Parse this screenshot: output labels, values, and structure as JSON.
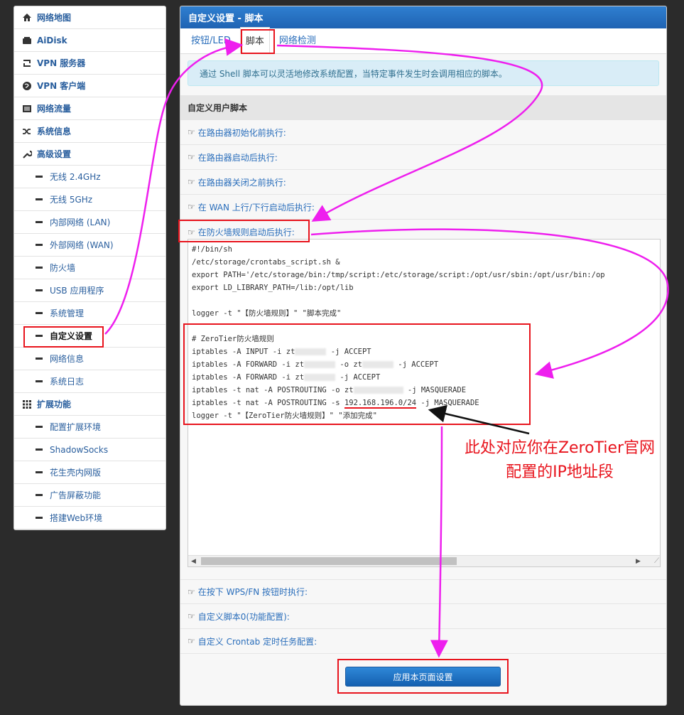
{
  "sidebar": {
    "items": [
      {
        "label": "网络地图",
        "icon": "home-icon"
      },
      {
        "label": "AiDisk",
        "icon": "disk-icon"
      },
      {
        "label": "VPN 服务器",
        "icon": "retweet-icon"
      },
      {
        "label": "VPN 客户端",
        "icon": "globe-icon"
      },
      {
        "label": "网络流量",
        "icon": "traffic-icon"
      },
      {
        "label": "系统信息",
        "icon": "shuffle-icon"
      },
      {
        "label": "高级设置",
        "icon": "wrench-icon"
      }
    ],
    "advanced_sub": [
      "无线 2.4GHz",
      "无线 5GHz",
      "内部网络 (LAN)",
      "外部网络 (WAN)",
      "防火墙",
      "USB 应用程序",
      "系统管理",
      "自定义设置",
      "网络信息",
      "系统日志"
    ],
    "ext_label": "扩展功能",
    "ext_sub": [
      "配置扩展环境",
      "ShadowSocks",
      "花生壳内网版",
      "广告屏蔽功能",
      "搭建Web环境"
    ]
  },
  "panel": {
    "title": "自定义设置 - 脚本",
    "tabs": [
      "按钮/LED",
      "脚本",
      "网络检测"
    ],
    "info": "通过 Shell 脚本可以灵活地修改系统配置，当特定事件发生时会调用相应的脚本。",
    "section_title": "自定义用户脚本",
    "rows": [
      "在路由器初始化前执行:",
      "在路由器启动后执行:",
      "在路由器关闭之前执行:",
      "在 WAN 上行/下行启动后执行:",
      "在防火墙规则启动后执行:"
    ],
    "rows_after": [
      "在按下 WPS/FN 按钮时执行:",
      "自定义脚本0(功能配置):",
      "自定义 Crontab 定时任务配置:"
    ],
    "apply_label": "应用本页面设置"
  },
  "code": {
    "l1": "#!/bin/sh",
    "l2": "/etc/storage/crontabs_script.sh &",
    "l3": "export PATH='/etc/storage/bin:/tmp/script:/etc/storage/script:/opt/usr/sbin:/opt/usr/bin:/op",
    "l4": "export LD_LIBRARY_PATH=/lib:/opt/lib",
    "l5": "",
    "l6": "logger -t \"【防火墙规则】\" \"脚本完成\"",
    "l7": "",
    "l8": "# ZeroTier防火墙规则",
    "l9a": "iptables -A INPUT -i zt",
    "l9b": " -j ACCEPT",
    "l10a": "iptables -A FORWARD -i zt",
    "l10b": " -o zt",
    "l10c": " -j ACCEPT",
    "l11a": "iptables -A FORWARD -i zt",
    "l11b": " -j ACCEPT",
    "l12a": "iptables -t nat -A POSTROUTING -o zt",
    "l12b": " -j MASQUERADE",
    "l13a": "iptables -t nat -A POSTROUTING -s ",
    "l13ip": "192.168.196.0/24",
    "l13b": " -j MASQUERADE",
    "l14": "logger -t \"【ZeroTier防火墙规则】\" \"添加完成\""
  },
  "annotation": {
    "line1": "此处对应你在ZeroTier官网",
    "line2": "配置的IP地址段",
    "color": "#e8141d",
    "arrow_color": "#ee1fee"
  }
}
